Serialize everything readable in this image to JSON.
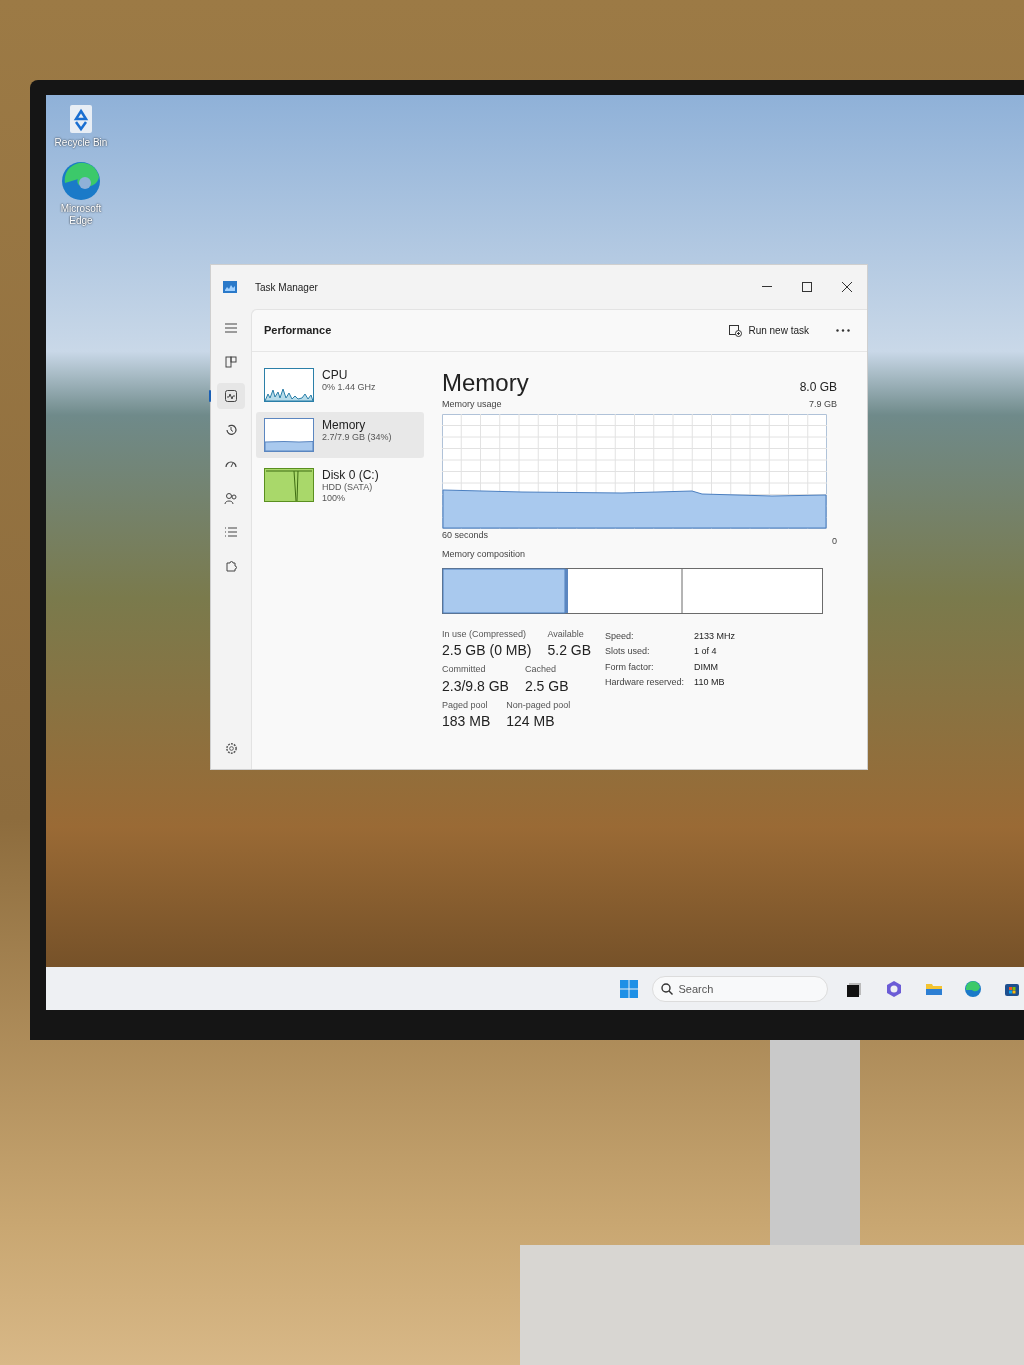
{
  "desktop_icons": [
    {
      "label": "Recycle Bin",
      "kind": "recycle"
    },
    {
      "label": "Microsoft Edge",
      "kind": "edge"
    }
  ],
  "window": {
    "title": "Task Manager"
  },
  "nav": [
    {
      "kind": "menu",
      "selected": false
    },
    {
      "kind": "processes",
      "selected": false
    },
    {
      "kind": "performance",
      "selected": true
    },
    {
      "kind": "history",
      "selected": false
    },
    {
      "kind": "startup",
      "selected": false
    },
    {
      "kind": "users",
      "selected": false
    },
    {
      "kind": "details",
      "selected": false
    },
    {
      "kind": "services",
      "selected": false
    }
  ],
  "page_title": "Performance",
  "run_new_task": "Run new task",
  "devices": [
    {
      "kind": "cpu",
      "name": "CPU",
      "details": [
        "0% 1.44 GHz"
      ],
      "selected": false
    },
    {
      "kind": "memory",
      "name": "Memory",
      "details": [
        "2.7/7.9 GB (34%)"
      ],
      "selected": true
    },
    {
      "kind": "disk",
      "name": "Disk 0 (C:)",
      "details": [
        "HDD (SATA)",
        "100%"
      ],
      "selected": false
    }
  ],
  "memory": {
    "title": "Memory",
    "total": "8.0 GB",
    "usage_label": "Memory usage",
    "usage_max": "7.9 GB",
    "time_span": "60 seconds",
    "usage_min": "0",
    "composition_label": "Memory composition",
    "stats": [
      [
        {
          "label": "In use (Compressed)",
          "value": "2.5 GB (0 MB)"
        },
        {
          "label": "Available",
          "value": "5.2 GB"
        }
      ],
      [
        {
          "label": "Committed",
          "value": "2.3/9.8 GB"
        },
        {
          "label": "Cached",
          "value": "2.5 GB"
        }
      ],
      [
        {
          "label": "Paged pool",
          "value": "183 MB"
        },
        {
          "label": "Non-paged pool",
          "value": "124 MB"
        }
      ]
    ],
    "specs": [
      {
        "label": "Speed:",
        "value": "2133 MHz"
      },
      {
        "label": "Slots used:",
        "value": "1 of 4"
      },
      {
        "label": "Form factor:",
        "value": "DIMM"
      },
      {
        "label": "Hardware reserved:",
        "value": "110 MB"
      }
    ]
  },
  "taskbar": {
    "search_placeholder": "Search"
  }
}
